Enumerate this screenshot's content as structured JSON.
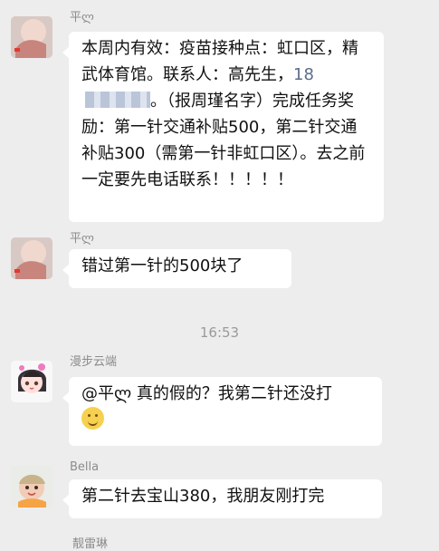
{
  "messages": [
    {
      "sender": "平ლ",
      "text": "本周内有效：疫苗接种点：虹口区，精武体育馆。联系人：高先生，",
      "phone_prefix": "18",
      "text_after_phone": "。（报周瑾名字）完成任务奖励：第一针交通补贴500，第二针交通补贴300（需第一针非虹口区）。去之前一定要先电话联系！！！！！"
    },
    {
      "sender": "平ლ",
      "text": "错过第一针的500块了"
    },
    {
      "sender": "漫步云端",
      "text": "@平ლ 真的假的？我第二针还没打",
      "emoji": "thinking-face-icon"
    },
    {
      "sender": "Bella",
      "text": "第二针去宝山380，我朋友刚打完"
    }
  ],
  "timestamp": "16:53",
  "partial_sender": "靓雷琳"
}
